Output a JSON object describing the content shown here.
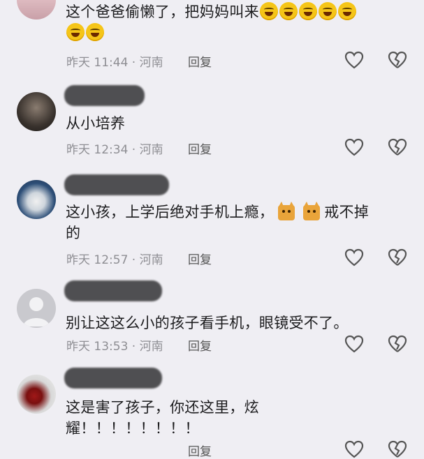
{
  "comments": [
    {
      "text_a": "这个爸爸偷懒了，把妈妈叫来",
      "time": "昨天 11:44 · 河南",
      "reply": "回复"
    },
    {
      "text": "从小培养",
      "time": "昨天 12:34 · 河南",
      "reply": "回复"
    },
    {
      "text_a": "这小孩，上学后绝对手机上瘾，",
      "text_b": "戒不掉",
      "text_c": "的",
      "time": "昨天 12:57 · 河南",
      "reply": "回复"
    },
    {
      "text": "别让这这么小的孩子看手机，眼镜受不了。",
      "time": "昨天 13:53 · 河南",
      "reply": "回复"
    },
    {
      "text_a": "这是害了孩子，你还这里，炫",
      "text_c": "耀！！！！！！！！",
      "reply": "回复"
    }
  ],
  "icons": {
    "like": "heart-outline-icon",
    "dislike": "broken-heart-icon",
    "emoji": "laughing-tears-emoji",
    "cat": "cat-emoji"
  }
}
